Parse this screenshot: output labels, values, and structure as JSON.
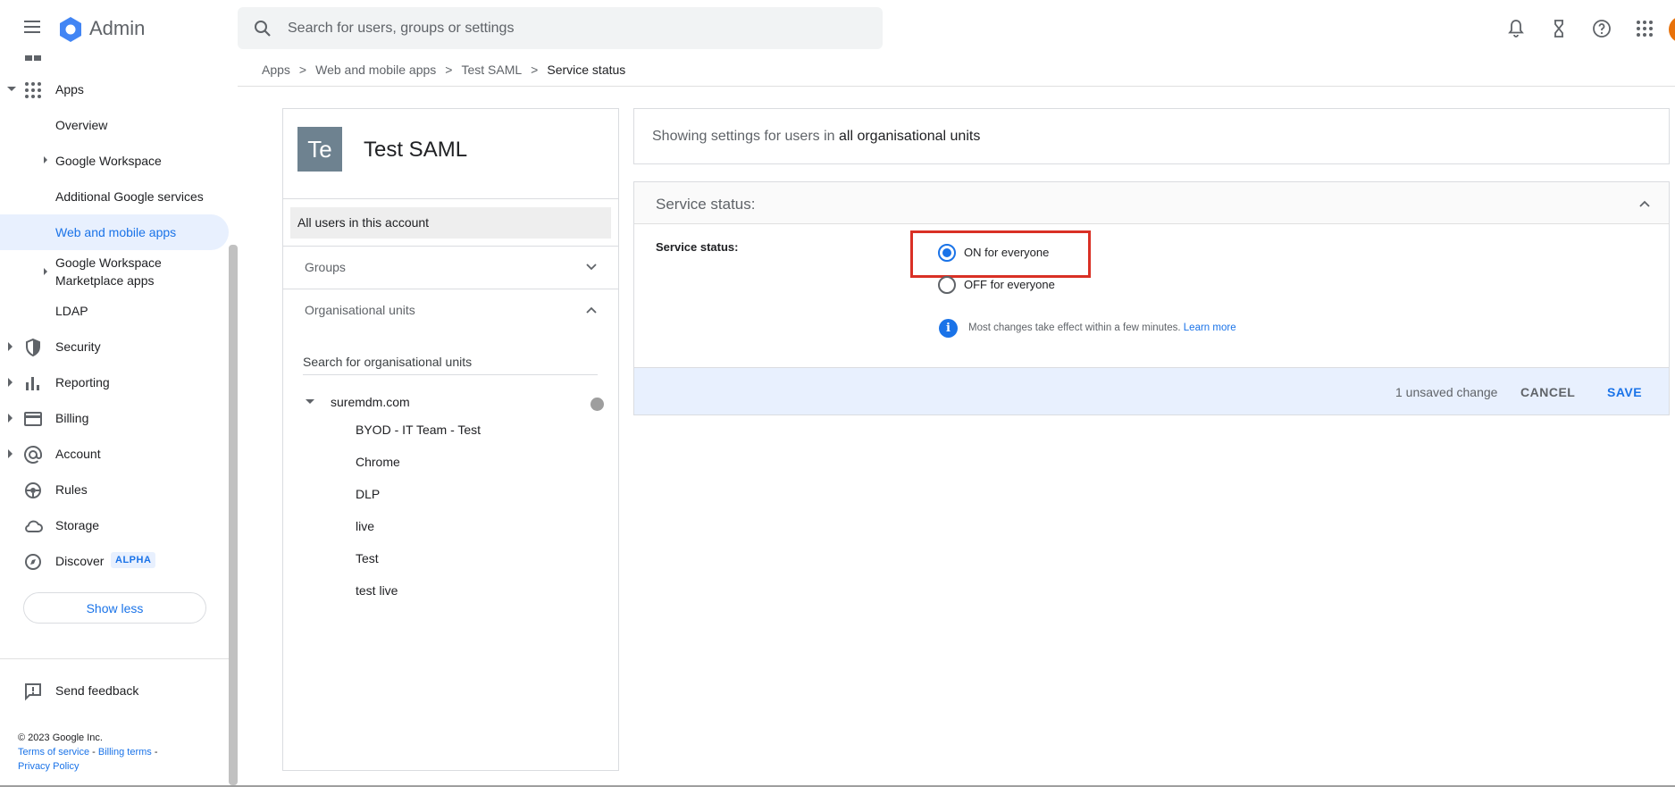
{
  "header": {
    "app_name": "Admin",
    "search_placeholder": "Search for users, groups or settings",
    "icons": [
      "menu-icon",
      "notifications-icon",
      "tasks-hourglass-icon",
      "help-icon",
      "apps-grid-icon"
    ]
  },
  "sidebar": {
    "apps_label": "Apps",
    "items": [
      {
        "label": "Overview"
      },
      {
        "label": "Google Workspace"
      },
      {
        "label": "Additional Google services"
      },
      {
        "label": "Web and mobile apps"
      },
      {
        "label": "Google Workspace Marketplace apps"
      },
      {
        "label": "LDAP"
      },
      {
        "label": "Security"
      },
      {
        "label": "Reporting"
      },
      {
        "label": "Billing"
      },
      {
        "label": "Account"
      },
      {
        "label": "Rules"
      },
      {
        "label": "Storage"
      },
      {
        "label": "Discover"
      }
    ],
    "discover_badge": "ALPHA",
    "show_less": "Show less",
    "send_feedback": "Send feedback",
    "copyright": "© 2023 Google Inc.",
    "terms": "Terms of service",
    "billing_terms": "Billing terms",
    "privacy": "Privacy Policy",
    "link_sep": "-"
  },
  "breadcrumb": {
    "items": [
      "Apps",
      "Web and mobile apps",
      "Test SAML"
    ],
    "current": "Service status",
    "sep": ">"
  },
  "app_card": {
    "tile": "Te",
    "name": "Test SAML",
    "all_users": "All users in this account",
    "groups": "Groups",
    "org_units": "Organisational units",
    "org_search_placeholder": "Search for organisational units",
    "root_org": "suremdm.com",
    "children": [
      "BYOD - IT Team - Test",
      "Chrome",
      "DLP",
      "live",
      "Test",
      "test live"
    ]
  },
  "scope": {
    "prefix": "Showing settings for users in",
    "target": "all organisational units"
  },
  "service_status": {
    "header": "Service status:",
    "field_label": "Service status:",
    "options": [
      {
        "label": "ON for everyone",
        "checked": true
      },
      {
        "label": "OFF for everyone",
        "checked": false
      }
    ],
    "info": "Most changes take effect within a few minutes.",
    "learn_more": "Learn more",
    "unsaved": "1 unsaved change",
    "cancel": "CANCEL",
    "save": "SAVE"
  },
  "colors": {
    "accent": "#1a73e8",
    "highlight": "#d93025",
    "active_bg": "#e8f0fe"
  }
}
